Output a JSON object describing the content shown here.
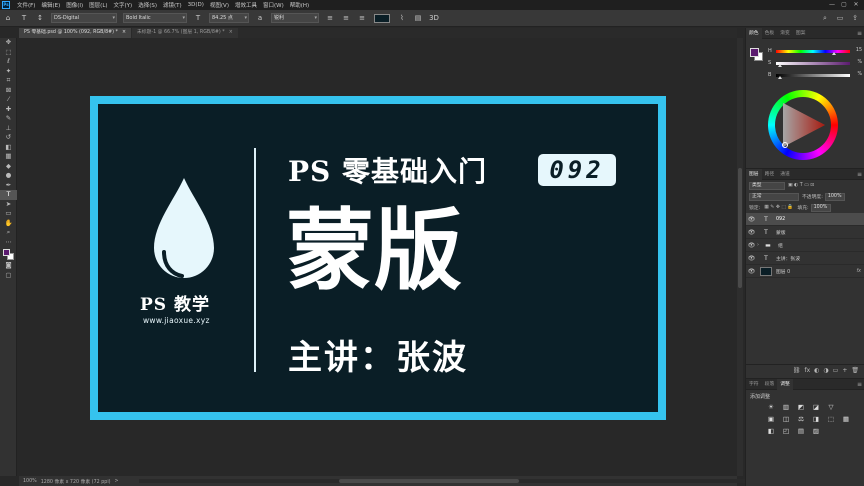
{
  "menubar": {
    "items": [
      "文件(F)",
      "编辑(E)",
      "图像(I)",
      "图层(L)",
      "文字(Y)",
      "选择(S)",
      "滤镜(T)",
      "3D(D)",
      "视图(V)",
      "增效工具",
      "窗口(W)",
      "帮助(H)"
    ],
    "window_controls": [
      "—",
      "▢",
      "✕"
    ]
  },
  "options": {
    "font_family": "DS-Digital",
    "font_style": "Bold Italic",
    "font_size": "84.25 点",
    "antialias": "锐利"
  },
  "tabs": [
    {
      "label": "PS 零基础.psd @ 100% (092, RGB/8#) *",
      "close": "×"
    },
    {
      "label": "未标题-1 @ 66.7% (图层 1, RGB/8#) *",
      "close": "×"
    }
  ],
  "canvas": {
    "brand_name": "PS 教学",
    "brand_url": "www.jiaoxue.xyz",
    "course_title": "PS 零基础入门",
    "episode_number": "092",
    "lesson_title": "蒙版",
    "lecturer": "主讲：张波"
  },
  "status": {
    "zoom": "100%",
    "doc_info": "1280 像素 x 720 像素 (72 ppi)",
    "arrow": ">"
  },
  "color_panel": {
    "tabs": [
      "颜色",
      "色板",
      "渐变",
      "图案"
    ],
    "sliders": [
      {
        "label": "H",
        "value": "15"
      },
      {
        "label": "S",
        "value": "%"
      },
      {
        "label": "B",
        "value": "%"
      }
    ]
  },
  "layers_panel": {
    "tabs": [
      "图层",
      "路径",
      "通道"
    ],
    "kind_filter": "类型",
    "blend_mode": "正常",
    "opacity_label": "不透明度:",
    "opacity_value": "100%",
    "lock_label": "锁定:",
    "fill_label": "填充:",
    "fill_value": "100%",
    "layers": [
      {
        "name": "092",
        "type": "T",
        "selected": true,
        "fx": ""
      },
      {
        "name": "蒙版",
        "type": "T",
        "selected": false,
        "fx": ""
      },
      {
        "name": "组",
        "type": "▬",
        "selected": false,
        "fx": ""
      },
      {
        "name": "主讲：张波",
        "type": "T",
        "selected": false,
        "fx": ""
      },
      {
        "name": "图层 0",
        "type": "fill",
        "selected": false,
        "fx": "fx"
      }
    ],
    "footer_icons": [
      "⛓",
      "fx",
      "◐",
      "◑",
      "▭",
      "+",
      "🗑"
    ]
  },
  "adjust_panel": {
    "tabs": [
      "字符",
      "段落",
      "调整"
    ],
    "title": "添加调整",
    "icons": [
      "☀",
      "▥",
      "◩",
      "◪",
      "▽",
      "",
      "▣",
      "◫",
      "⚖",
      "◨",
      "⬚",
      "▦",
      "◧",
      "◰",
      "▤",
      "▨",
      "",
      ""
    ]
  },
  "colors": {
    "accent_border": "#35c3ee",
    "artboard_bg": "#0a1e26",
    "foreground_swatch": "#5a1a6e"
  }
}
